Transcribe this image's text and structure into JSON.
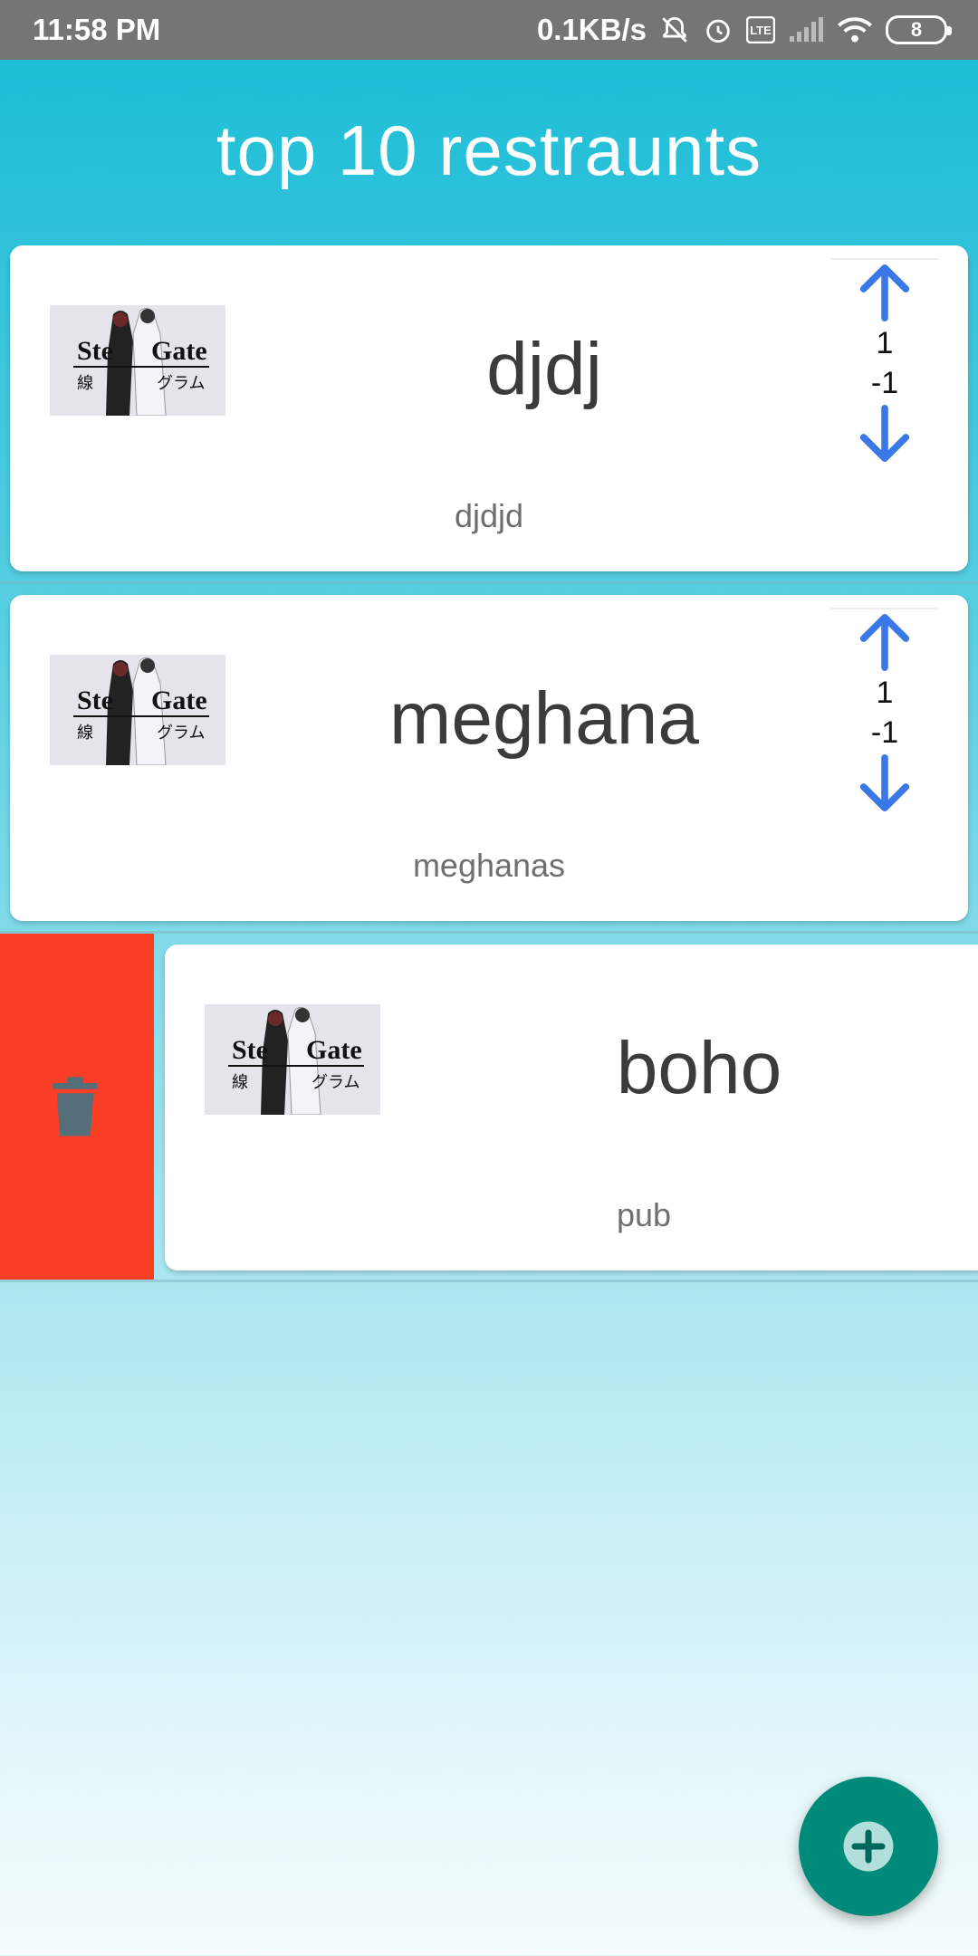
{
  "status_bar": {
    "time": "11:58 PM",
    "network_speed": "0.1KB/s",
    "battery_level": "8",
    "icons": [
      "mute-icon",
      "alarm-icon",
      "volte-icon",
      "signal-icon",
      "wifi-icon",
      "battery-icon"
    ]
  },
  "app_bar": {
    "title": "top 10 restraunts"
  },
  "restaurants": [
    {
      "name": "djdj",
      "subtitle": "djdjd",
      "upvotes": "1",
      "downvotes": "-1",
      "image_text": "Steins;Gate"
    },
    {
      "name": "meghana",
      "subtitle": "meghanas",
      "upvotes": "1",
      "downvotes": "-1",
      "image_text": "Steins;Gate"
    },
    {
      "name": "boho",
      "subtitle": "pub",
      "image_text": "Steins;Gate"
    }
  ],
  "swipe_action": {
    "icon": "trash-icon",
    "color": "#fb3f26"
  },
  "fab": {
    "icon": "add-icon",
    "color": "#008a7a"
  },
  "colors": {
    "accent": "#17bcd6",
    "arrow": "#3b78e7"
  }
}
